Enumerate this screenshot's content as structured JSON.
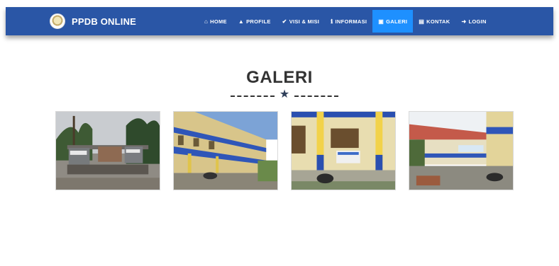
{
  "brand": {
    "name": "PPDB ONLINE",
    "logo_icon": "school-emblem-icon"
  },
  "nav": {
    "items": [
      {
        "label": "HOME",
        "icon": "home-icon",
        "glyph": "⌂",
        "active": false
      },
      {
        "label": "PROFILE",
        "icon": "user-icon",
        "glyph": "▲",
        "active": false
      },
      {
        "label": "VISI & MISI",
        "icon": "check-icon",
        "glyph": "✔",
        "active": false
      },
      {
        "label": "INFORMASI",
        "icon": "info-icon",
        "glyph": "ℹ",
        "active": false
      },
      {
        "label": "GALERI",
        "icon": "image-icon",
        "glyph": "▣",
        "active": true
      },
      {
        "label": "KONTAK",
        "icon": "contact-card-icon",
        "glyph": "▤",
        "active": false
      },
      {
        "label": "LOGIN",
        "icon": "sign-in-icon",
        "glyph": "➜",
        "active": false
      }
    ]
  },
  "section": {
    "title": "GALERI",
    "divider_icon": "star-icon"
  },
  "gallery": {
    "images": [
      {
        "subject": "school-gate-photo"
      },
      {
        "subject": "school-building-corridor-photo"
      },
      {
        "subject": "classroom-front-photo"
      },
      {
        "subject": "school-courtyard-photo"
      }
    ]
  },
  "colors": {
    "navbar": "#2a56a6",
    "active_nav": "#1e90ff",
    "title": "#333333"
  }
}
